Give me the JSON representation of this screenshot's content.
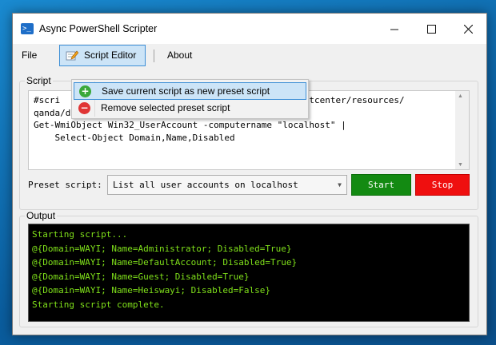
{
  "window": {
    "title": "Async PowerShell Scripter",
    "icon": "powershell-icon",
    "controls": {
      "minimize": "—",
      "maximize": "☐",
      "close": "✕"
    }
  },
  "menu": {
    "file": "File",
    "script_editor": "Script Editor",
    "about": "About"
  },
  "dropdown": {
    "items": [
      {
        "label": "Save current script as new preset script",
        "icon": "add-icon"
      },
      {
        "label": "Remove selected preset script",
        "icon": "remove-icon"
      }
    ]
  },
  "script_group": {
    "title": "Script",
    "editor_lines": [
      "#scri                                         /scriptcenter/resources/",
      "qanda/default.mspx",
      "Get-WmiObject Win32_UserAccount -computername \"localhost\" |",
      "    Select-Object Domain,Name,Disabled"
    ],
    "preset_label": "Preset script:",
    "preset_value": "List all user accounts on localhost",
    "start_label": "Start",
    "stop_label": "Stop"
  },
  "output_group": {
    "title": "Output",
    "lines": [
      "Starting script...",
      "@{Domain=WAYI; Name=Administrator; Disabled=True}",
      "@{Domain=WAYI; Name=DefaultAccount; Disabled=True}",
      "@{Domain=WAYI; Name=Guest; Disabled=True}",
      "@{Domain=WAYI; Name=Heiswayi; Disabled=False}",
      "Starting script complete."
    ]
  },
  "colors": {
    "start_button": "#138a12",
    "stop_button": "#ef0f0f",
    "output_text": "#7fe01a",
    "output_background": "#000000",
    "menu_highlight": "#cce4f7"
  }
}
